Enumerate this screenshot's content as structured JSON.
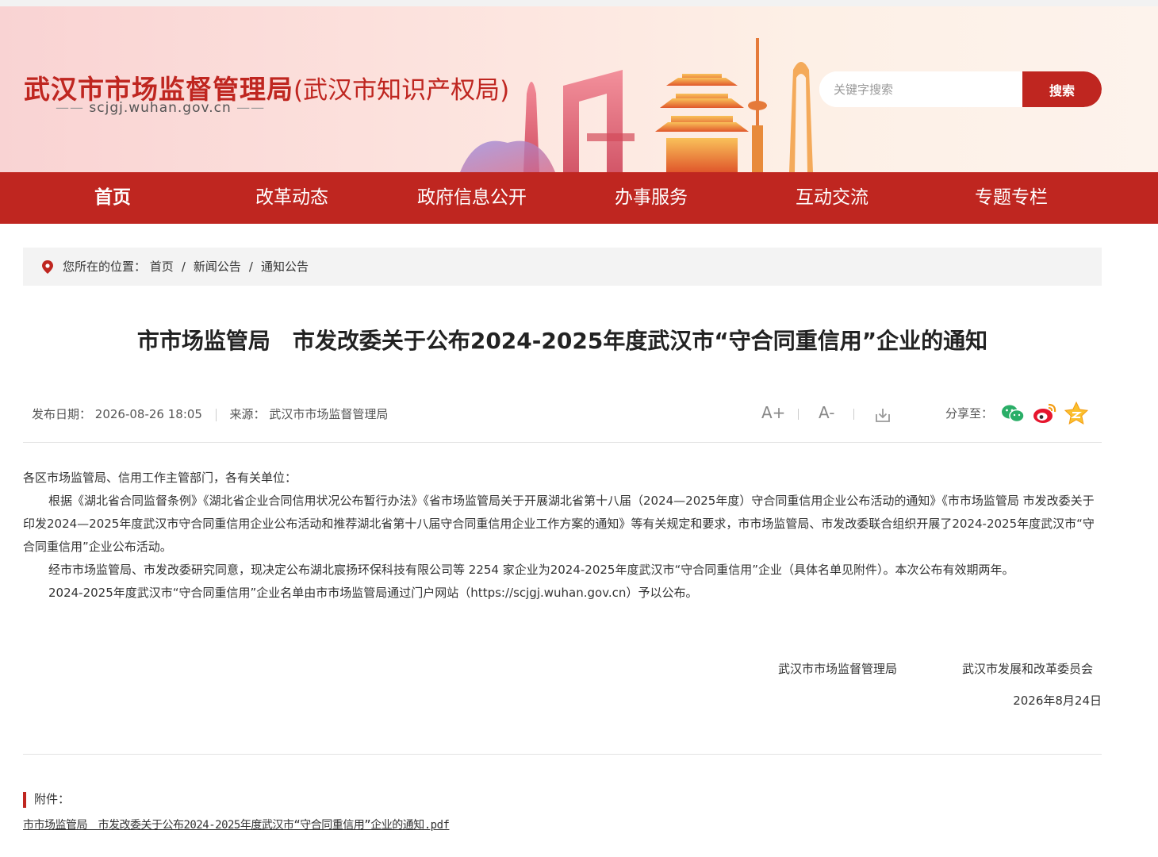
{
  "header": {
    "title": "武汉市市场监督管理局",
    "subtitle": "(武汉市知识产权局)",
    "domain": "scjgj.wuhan.gov.cn",
    "search": {
      "placeholder": "关键字搜索",
      "button": "搜索"
    }
  },
  "nav": {
    "items": [
      {
        "label": "首页"
      },
      {
        "label": "改革动态"
      },
      {
        "label": "政府信息公开"
      },
      {
        "label": "办事服务"
      },
      {
        "label": "互动交流"
      },
      {
        "label": "专题专栏"
      }
    ]
  },
  "breadcrumb": {
    "prefix": "您所在的位置：",
    "items": [
      "首页",
      "新闻公告",
      "通知公告"
    ],
    "separator": "/"
  },
  "article": {
    "title": "市市场监管局　市发改委关于公布2024-2025年度武汉市“守合同重信用”企业的通知",
    "date_label": "发布日期：",
    "date": "2026-08-26 18:05",
    "source_label": "来源：",
    "source": "武汉市市场监督管理局",
    "tools": {
      "font_larger": "A+",
      "font_smaller": "A-"
    },
    "share_label": "分享至：",
    "salutation": "各区市场监管局、信用工作主管部门，各有关单位：",
    "paragraphs": [
      "根据《湖北省合同监督条例》《湖北省企业合同信用状况公布暂行办法》《省市场监管局关于开展湖北省第十八届（2024—2025年度）守合同重信用企业公布活动的通知》《市市场监管局 市发改委关于印发2024—2025年度武汉市守合同重信用企业公布活动和推荐湖北省第十八届守合同重信用企业工作方案的通知》等有关规定和要求，市市场监管局、市发改委联合组织开展了2024-2025年度武汉市“守合同重信用”企业公布活动。",
      "经市市场监管局、市发改委研究同意，现决定公布湖北宸扬环保科技有限公司等 2254 家企业为2024-2025年度武汉市“守合同重信用”企业（具体名单见附件）。本次公布有效期两年。",
      "2024-2025年度武汉市“守合同重信用”企业名单由市市场监管局通过门户网站（https://scjgj.wuhan.gov.cn）予以公布。"
    ],
    "signers": [
      "武汉市市场监督管理局",
      "武汉市发展和改革委员会"
    ],
    "sign_date": "2026年8月24日",
    "attachment_label": "附件：",
    "attachment_file": "市市场监管局　市发改委关于公布2024-2025年度武汉市“守合同重信用”企业的通知.pdf"
  },
  "colors": {
    "brand": "#bf2620",
    "nav_text": "#ffffff"
  }
}
